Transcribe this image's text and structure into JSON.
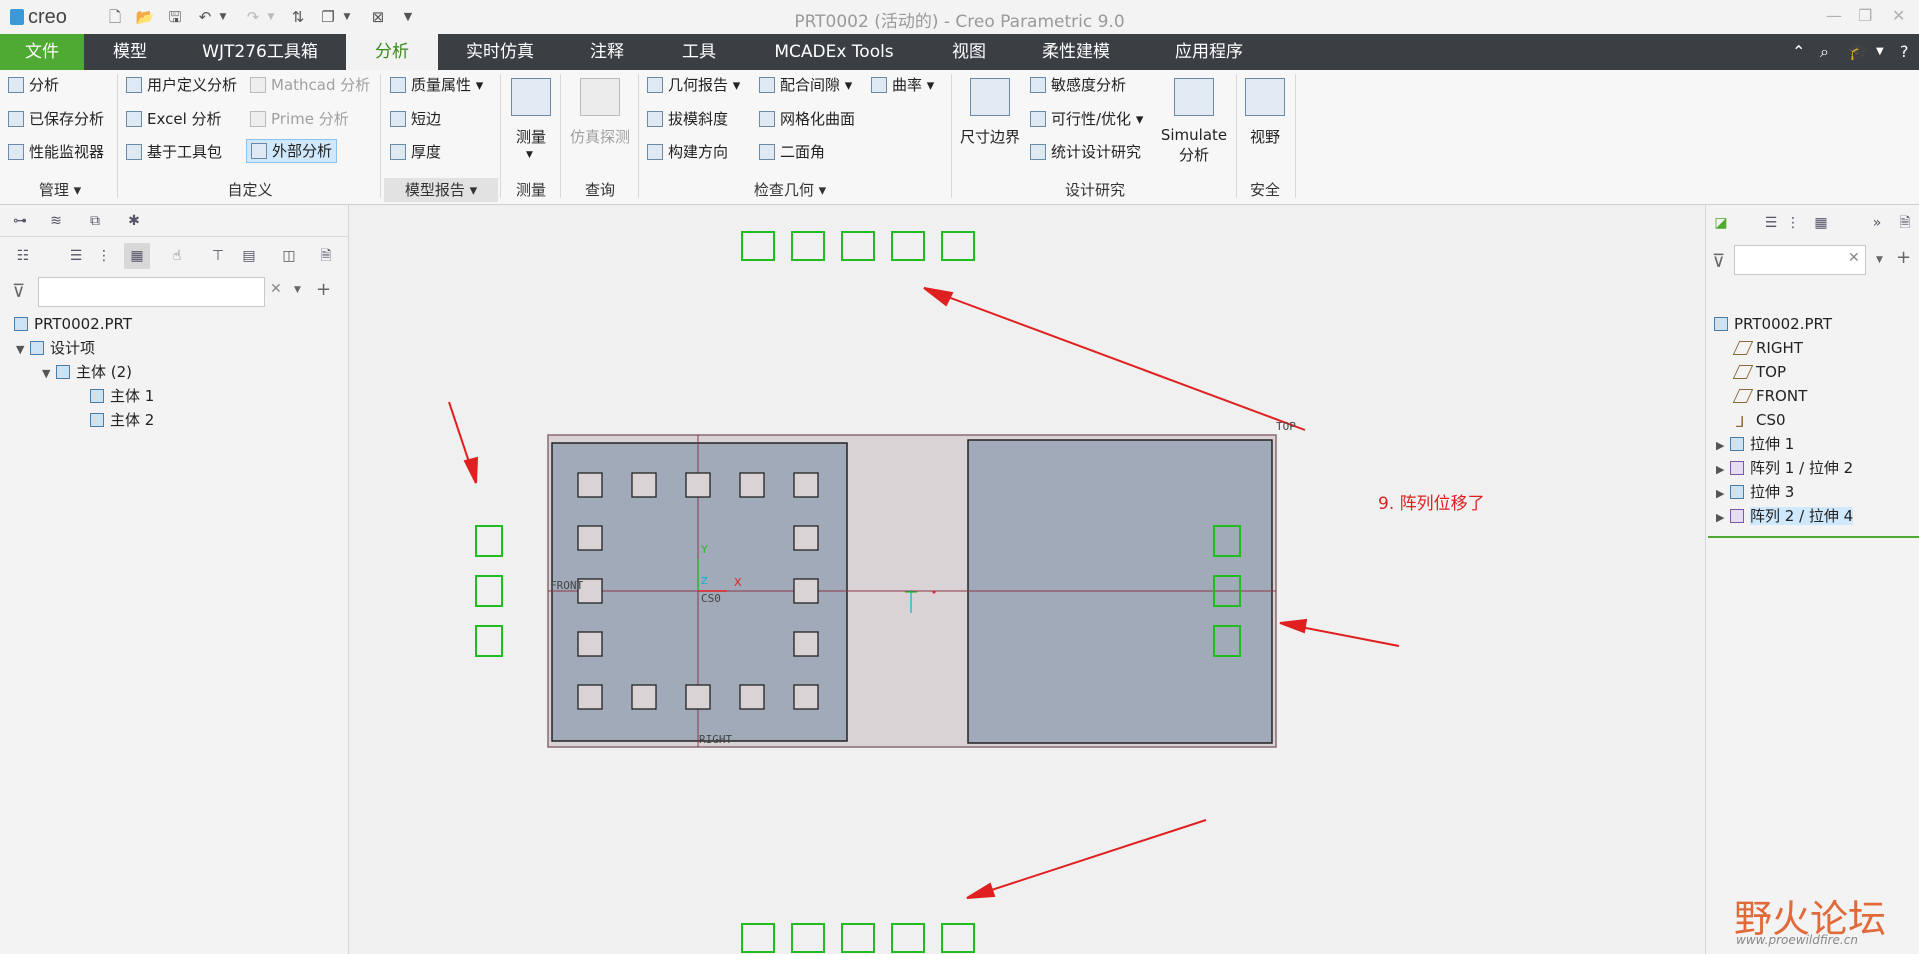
{
  "titlebar": {
    "logo": "creo",
    "title": "PRT0002 (活动的) - Creo Parametric 9.0"
  },
  "menu": {
    "items": [
      "文件",
      "模型",
      "WJT276工具箱",
      "分析",
      "实时仿真",
      "注释",
      "工具",
      "MCADEx Tools",
      "视图",
      "柔性建模",
      "应用程序"
    ],
    "active": "分析"
  },
  "ribbon": {
    "manage": {
      "items": [
        "分析",
        "已保存分析",
        "性能监视器"
      ],
      "label": "管理"
    },
    "custom": {
      "col1": [
        "用户定义分析",
        "Excel 分析",
        "基于工具包"
      ],
      "col2": [
        "Mathcad 分析",
        "Prime 分析",
        "外部分析"
      ],
      "label": "自定义"
    },
    "model_report": {
      "items": [
        "质量属性",
        "短边",
        "厚度"
      ],
      "label": "模型报告"
    },
    "measure": {
      "button": "测量",
      "label": "测量"
    },
    "query": {
      "button": "仿真探测",
      "label": "查询"
    },
    "inspect": {
      "col1": [
        "几何报告",
        "拔模斜度",
        "构建方向"
      ],
      "col2": [
        "配合间隙",
        "网格化曲面",
        "二面角"
      ],
      "col3": [
        "曲率"
      ],
      "label": "检查几何"
    },
    "design_study": {
      "big1": "尺寸边界",
      "col": [
        "敏感度分析",
        "可行性/优化",
        "统计设计研究"
      ],
      "big2_line1": "Simulate",
      "big2_line2": "分析",
      "label": "设计研究"
    },
    "safety": {
      "button": "视野",
      "label": "安全"
    }
  },
  "left_panel": {
    "filter_placeholder": "",
    "tree": [
      {
        "label": "PRT0002.PRT",
        "depth": 0
      },
      {
        "label": "设计项",
        "depth": 1
      },
      {
        "label": "主体 (2)",
        "depth": 2
      },
      {
        "label": "主体 1",
        "depth": 3
      },
      {
        "label": "主体 2",
        "depth": 3
      }
    ]
  },
  "right_panel": {
    "tree": [
      {
        "label": "PRT0002.PRT",
        "icon": "part-icon"
      },
      {
        "label": "RIGHT",
        "icon": "plane-icon"
      },
      {
        "label": "TOP",
        "icon": "plane-icon"
      },
      {
        "label": "FRONT",
        "icon": "plane-icon"
      },
      {
        "label": "CS0",
        "icon": "csys-icon"
      },
      {
        "label": "拉伸 1",
        "icon": "extrude-icon"
      },
      {
        "label": "阵列 1 / 拉伸 2",
        "icon": "pattern-icon"
      },
      {
        "label": "拉伸 3",
        "icon": "extrude-icon"
      },
      {
        "label": "阵列 2 / 拉伸 4",
        "icon": "pattern-icon"
      }
    ]
  },
  "graphics": {
    "annotation": "9. 阵列位移了",
    "labels": {
      "top": "TOP",
      "front": "FRONT",
      "right": "RIGHT",
      "csys": "CS0",
      "x": "X",
      "y": "Y",
      "z": "Z"
    },
    "watermark_main": "野火论坛",
    "watermark_url": "www.proewildfire.cn"
  },
  "colors": {
    "menubar": "#3a3f44",
    "file_tab": "#4faa34",
    "annotation": "#e02020",
    "pattern_box": "#22bb22",
    "part_fill": "#a0aab8"
  }
}
